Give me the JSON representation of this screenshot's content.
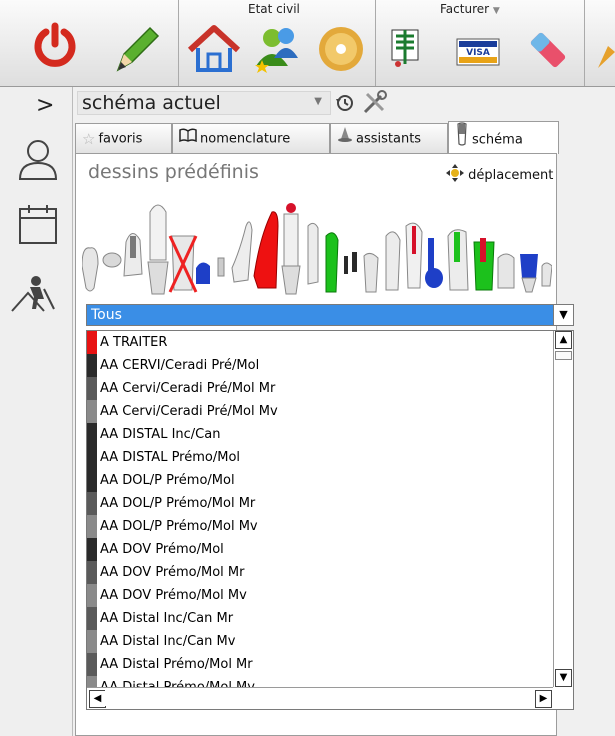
{
  "toolbar": {
    "etat_civil_label": "Etat civil",
    "facturer_label": "Facturer",
    "visa_label": "VISA",
    "colors": {
      "power": "#d42a1e",
      "pencil": "#5ab02f",
      "house": "#c8332a"
    }
  },
  "leftrail": {
    "expand_glyph": ">",
    "icons": [
      "user-icon",
      "calendar-icon",
      "worker-icon"
    ]
  },
  "panel": {
    "schema_select_value": "schéma actuel",
    "tabs": [
      {
        "label": "favoris",
        "icon": "star-icon"
      },
      {
        "label": "nomenclature",
        "icon": "book-icon"
      },
      {
        "label": "assistants",
        "icon": "wizard-icon"
      },
      {
        "label": "schéma",
        "icon": "tooth-icon",
        "active": true
      }
    ],
    "dessins_title": "dessins prédéfinis",
    "deplacement_label": "déplacement",
    "filter_value": "Tous",
    "list_items": [
      {
        "label": "A TRAITER",
        "color": "#e81212"
      },
      {
        "label": "AA CERVI/Ceradi Pré/Mol",
        "color": "#2a2a2a"
      },
      {
        "label": "AA Cervi/Ceradi Pré/Mol Mr",
        "color": "#5a5a5a"
      },
      {
        "label": "AA Cervi/Ceradi Pré/Mol Mv",
        "color": "#8a8a8a"
      },
      {
        "label": "AA DISTAL Inc/Can",
        "color": "#2a2a2a"
      },
      {
        "label": "AA DISTAL Prémo/Mol",
        "color": "#2a2a2a"
      },
      {
        "label": "AA DOL/P Prémo/Mol",
        "color": "#2a2a2a"
      },
      {
        "label": "AA DOL/P Prémo/Mol Mr",
        "color": "#5a5a5a"
      },
      {
        "label": "AA DOL/P Prémo/Mol Mv",
        "color": "#8a8a8a"
      },
      {
        "label": "AA DOV Prémo/Mol",
        "color": "#2a2a2a"
      },
      {
        "label": "AA DOV Prémo/Mol Mr",
        "color": "#5a5a5a"
      },
      {
        "label": "AA DOV Prémo/Mol Mv",
        "color": "#8a8a8a"
      },
      {
        "label": "AA Distal Inc/Can Mr",
        "color": "#5a5a5a"
      },
      {
        "label": "AA Distal Inc/Can Mv",
        "color": "#8a8a8a"
      },
      {
        "label": "AA Distal Prémo/Mol Mr",
        "color": "#5a5a5a"
      },
      {
        "label": "AA Distal Prémo/Mol Mv",
        "color": "#8a8a8a"
      }
    ]
  }
}
